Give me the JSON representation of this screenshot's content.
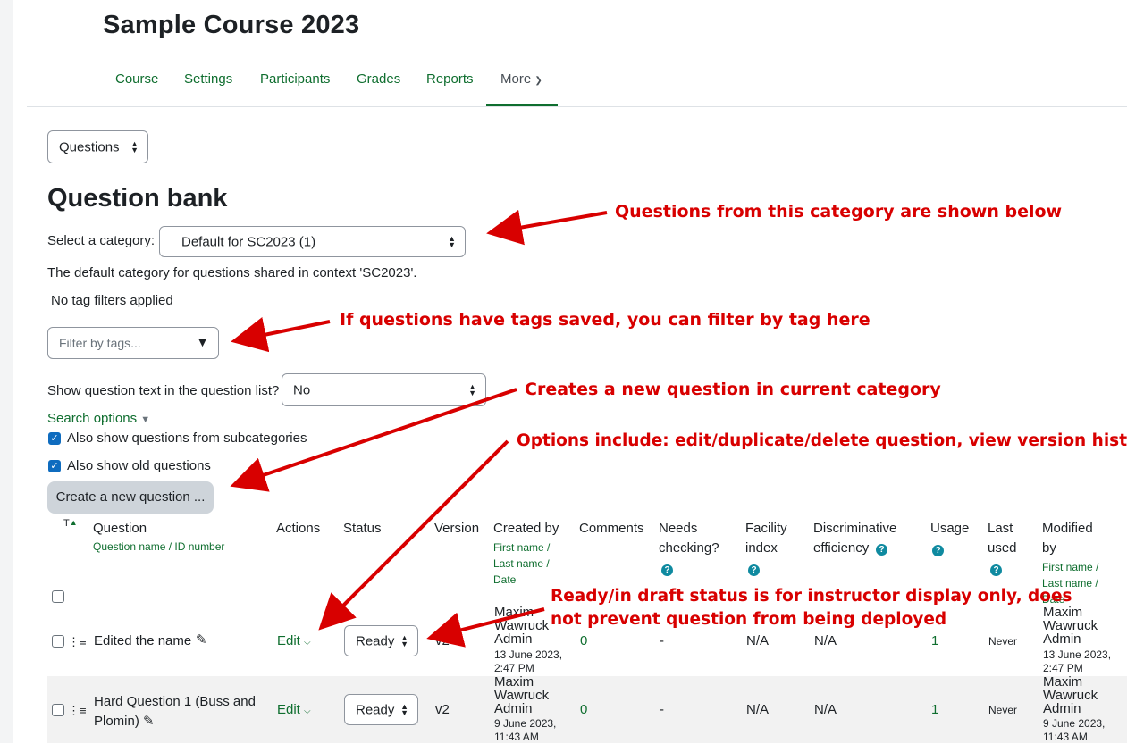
{
  "course": {
    "title": "Sample Course 2023"
  },
  "nav": {
    "items": [
      "Course",
      "Settings",
      "Participants",
      "Grades",
      "Reports"
    ],
    "more_label": "More"
  },
  "page_select": {
    "value": "Questions"
  },
  "question_bank": {
    "heading": "Question bank",
    "category_label": "Select a category:",
    "category_value": "Default for SC2023 (1)",
    "category_description": "The default category for questions shared in context 'SC2023'.",
    "tag_status": "No tag filters applied",
    "tag_placeholder": "Filter by tags...",
    "show_text_label": "Show question text in the question list?",
    "show_text_value": "No",
    "search_options": "Search options",
    "subcategories_label": "Also show questions from subcategories",
    "old_questions_label": "Also show old questions",
    "create_button": "Create a new question ..."
  },
  "table": {
    "sort_label": "T",
    "headers": {
      "question": "Question",
      "question_sub": "Question name / ID number",
      "actions": "Actions",
      "status": "Status",
      "version": "Version",
      "created_by": "Created by",
      "created_sub": [
        "First name /",
        "Last name /",
        "Date"
      ],
      "comments": "Comments",
      "needs_checking": [
        "Needs",
        "checking?"
      ],
      "facility": [
        "Facility",
        "index"
      ],
      "discriminative": [
        "Discriminative",
        "efficiency"
      ],
      "usage": "Usage",
      "last_used": [
        "Last",
        "used"
      ],
      "modified_by": [
        "Modified",
        "by"
      ],
      "modified_sub": [
        "First name /",
        "Last name /",
        "Date"
      ]
    },
    "rows": [
      {
        "name": "Edited the name",
        "action": "Edit",
        "status": "Ready",
        "version": "v2",
        "creator": [
          "Maxim",
          "Wawruck",
          "Admin"
        ],
        "created_date": [
          "13 June 2023,",
          "2:47 PM"
        ],
        "comments": "0",
        "needs_checking": "-",
        "facility": "N/A",
        "discriminative": "N/A",
        "usage": "1",
        "last_used": "Never",
        "modifier": [
          "Maxim",
          "Wawruck",
          "Admin"
        ],
        "modified_date": [
          "13 June 2023,",
          "2:47 PM"
        ]
      },
      {
        "name_lines": [
          "Hard Question 1 (Buss and",
          "Plomin)"
        ],
        "action": "Edit",
        "status": "Ready",
        "version": "v2",
        "creator": [
          "Maxim",
          "Wawruck",
          "Admin"
        ],
        "created_date": [
          "9 June 2023,",
          "11:43 AM"
        ],
        "comments": "0",
        "needs_checking": "-",
        "facility": "N/A",
        "discriminative": "N/A",
        "usage": "1",
        "last_used": "Never",
        "modifier": [
          "Maxim",
          "Wawruck",
          "Admin"
        ],
        "modified_date": [
          "9 June 2023,",
          "11:43 AM"
        ]
      }
    ]
  },
  "annotations": {
    "category": "Questions from this category are shown below",
    "tags": "If questions have tags saved, you can filter by tag here",
    "create": "Creates a new question in current category",
    "options": "Options include: edit/duplicate/delete question, view version history",
    "status_line1": "Ready/in draft status is for instructor display only, does",
    "status_line2": "not prevent question from being deployed"
  },
  "colors": {
    "link": "#0f6e2f",
    "annotation": "#d80000",
    "checkbox": "#0f6cbf",
    "help_icon": "#0f8aa0"
  }
}
